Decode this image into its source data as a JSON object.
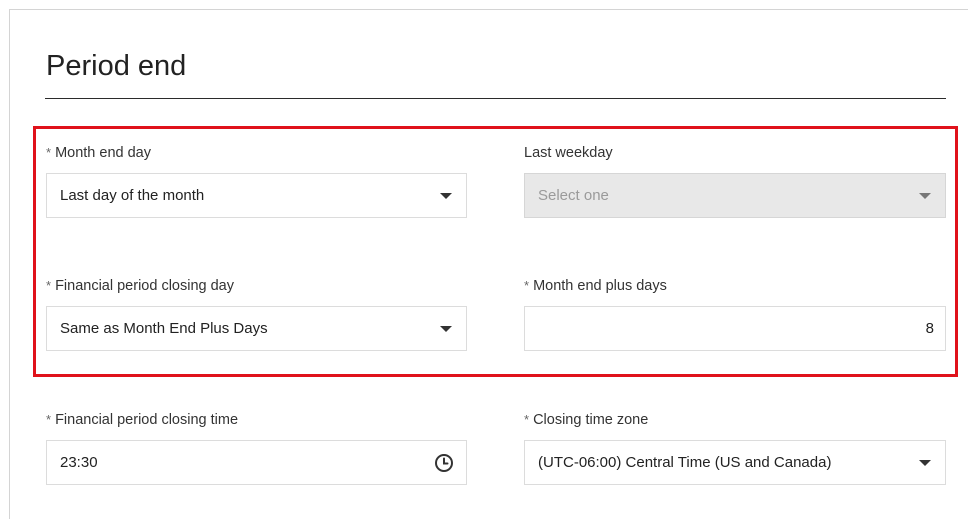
{
  "page": {
    "title": "Period end"
  },
  "fields": {
    "month_end_day": {
      "label": "Month end day",
      "required": "*",
      "value": "Last day of the month",
      "icon": "chevron-down-icon"
    },
    "last_weekday": {
      "label": "Last weekday",
      "value": "Select one",
      "disabled": true,
      "icon": "chevron-down-icon"
    },
    "closing_day": {
      "label": "Financial period closing day",
      "required": "*",
      "value": "Same as Month End Plus Days",
      "icon": "chevron-down-icon"
    },
    "plus_days": {
      "label": "Month end plus days",
      "required": "*",
      "value": "8"
    },
    "closing_time": {
      "label": "Financial period closing time",
      "required": "*",
      "value": "23:30",
      "icon": "clock-icon"
    },
    "time_zone": {
      "label": "Closing time zone",
      "required": "*",
      "value": "(UTC-06:00) Central Time (US and Canada)",
      "icon": "chevron-down-icon"
    }
  },
  "highlight_color": "#e0121b"
}
